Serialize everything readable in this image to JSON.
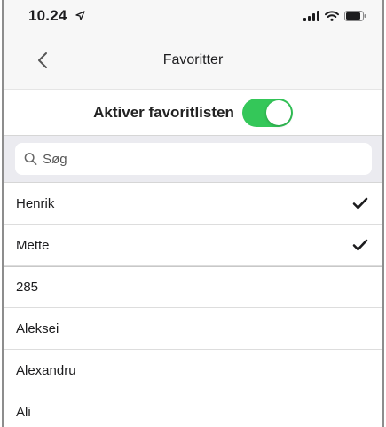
{
  "status_bar": {
    "time": "10.24",
    "location_icon": "location-arrow-icon",
    "signal_icon": "cellular-signal-icon",
    "wifi_icon": "wifi-icon",
    "battery_icon": "battery-icon"
  },
  "nav": {
    "back_icon": "chevron-left-icon",
    "title": "Favoritter"
  },
  "favorites_toggle": {
    "label": "Aktiver favoritlisten",
    "enabled": true,
    "on_color": "#34c759"
  },
  "search": {
    "placeholder": "Søg",
    "value": ""
  },
  "contacts": [
    {
      "name": "Henrik",
      "selected": true
    },
    {
      "name": "Mette",
      "selected": true
    },
    {
      "name": "285",
      "selected": false
    },
    {
      "name": "Aleksei",
      "selected": false
    },
    {
      "name": "Alexandru",
      "selected": false
    },
    {
      "name": "Ali",
      "selected": false
    }
  ],
  "colors": {
    "accent_green": "#34c759",
    "checkmark": "#1c1c1e",
    "bar_background": "#f7f7f7",
    "search_background": "#ebebf0"
  }
}
